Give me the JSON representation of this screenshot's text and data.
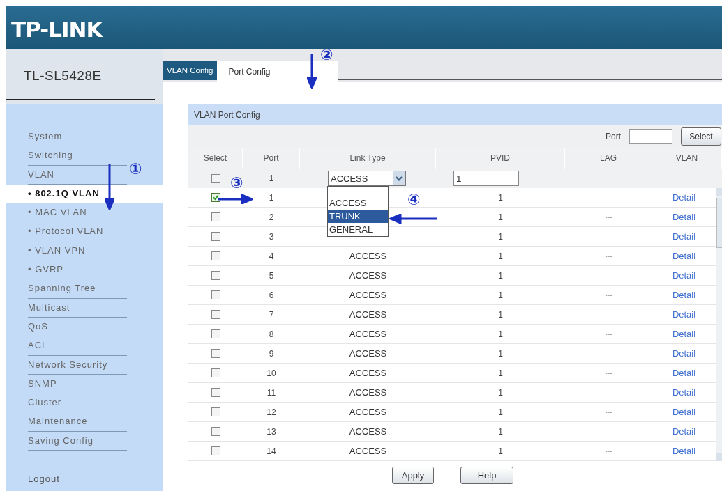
{
  "header": {
    "logo": "TP-LINK"
  },
  "sidebar": {
    "model": "TL-SL5428E",
    "items": [
      {
        "label": "System",
        "kind": "section",
        "selected": false
      },
      {
        "label": "Switching",
        "kind": "section",
        "selected": false
      },
      {
        "label": "VLAN",
        "kind": "section",
        "selected": false
      },
      {
        "label": "• 802.1Q VLAN",
        "kind": "sub",
        "selected": true
      },
      {
        "label": "• MAC VLAN",
        "kind": "sub",
        "selected": false
      },
      {
        "label": "• Protocol VLAN",
        "kind": "sub",
        "selected": false
      },
      {
        "label": "• VLAN VPN",
        "kind": "sub",
        "selected": false
      },
      {
        "label": "• GVRP",
        "kind": "sub",
        "selected": false
      },
      {
        "label": "Spanning Tree",
        "kind": "section",
        "selected": false
      },
      {
        "label": "Multicast",
        "kind": "section",
        "selected": false
      },
      {
        "label": "QoS",
        "kind": "section",
        "selected": false
      },
      {
        "label": "ACL",
        "kind": "section",
        "selected": false
      },
      {
        "label": "Network Security",
        "kind": "section",
        "selected": false
      },
      {
        "label": "SNMP",
        "kind": "section",
        "selected": false
      },
      {
        "label": "Cluster",
        "kind": "section",
        "selected": false
      },
      {
        "label": "Maintenance",
        "kind": "section",
        "selected": false
      },
      {
        "label": "Saving Config",
        "kind": "section",
        "selected": false
      }
    ],
    "logout": "Logout"
  },
  "tabs": [
    {
      "label": "VLAN Config",
      "selected": false
    },
    {
      "label": "Port Config",
      "selected": true
    }
  ],
  "panel": {
    "title": "VLAN Port Config",
    "port_label": "Port",
    "select_button": "Select",
    "columns": [
      "Select",
      "Port",
      "Link Type",
      "PVID",
      "LAG",
      "VLAN"
    ],
    "edit_row": {
      "checked": false,
      "port": "1",
      "link_type": "ACCESS",
      "pvid": "1"
    },
    "dropdown": [
      {
        "label": "ACCESS",
        "selected": false
      },
      {
        "label": "TRUNK",
        "selected": true
      },
      {
        "label": "GENERAL",
        "selected": false
      }
    ],
    "rows": [
      {
        "checked": true,
        "port": "1",
        "pvid": "1",
        "lag": "---",
        "vlan": "Detail"
      },
      {
        "checked": false,
        "port": "2",
        "pvid": "1",
        "lag": "---",
        "vlan": "Detail"
      },
      {
        "checked": false,
        "port": "3",
        "pvid": "1",
        "lag": "---",
        "vlan": "Detail"
      },
      {
        "checked": false,
        "port": "4",
        "link_type": "ACCESS",
        "pvid": "1",
        "lag": "---",
        "vlan": "Detail"
      },
      {
        "checked": false,
        "port": "5",
        "link_type": "ACCESS",
        "pvid": "1",
        "lag": "---",
        "vlan": "Detail"
      },
      {
        "checked": false,
        "port": "6",
        "link_type": "ACCESS",
        "pvid": "1",
        "lag": "---",
        "vlan": "Detail"
      },
      {
        "checked": false,
        "port": "7",
        "link_type": "ACCESS",
        "pvid": "1",
        "lag": "---",
        "vlan": "Detail"
      },
      {
        "checked": false,
        "port": "8",
        "link_type": "ACCESS",
        "pvid": "1",
        "lag": "---",
        "vlan": "Detail"
      },
      {
        "checked": false,
        "port": "9",
        "link_type": "ACCESS",
        "pvid": "1",
        "lag": "---",
        "vlan": "Detail"
      },
      {
        "checked": false,
        "port": "10",
        "link_type": "ACCESS",
        "pvid": "1",
        "lag": "---",
        "vlan": "Detail"
      },
      {
        "checked": false,
        "port": "11",
        "link_type": "ACCESS",
        "pvid": "1",
        "lag": "---",
        "vlan": "Detail"
      },
      {
        "checked": false,
        "port": "12",
        "link_type": "ACCESS",
        "pvid": "1",
        "lag": "---",
        "vlan": "Detail"
      },
      {
        "checked": false,
        "port": "13",
        "link_type": "ACCESS",
        "pvid": "1",
        "lag": "---",
        "vlan": "Detail"
      },
      {
        "checked": false,
        "port": "14",
        "link_type": "ACCESS",
        "pvid": "1",
        "lag": "---",
        "vlan": "Detail"
      }
    ],
    "buttons": [
      "Apply",
      "Help"
    ]
  },
  "annotations": [
    {
      "label": "①"
    },
    {
      "label": "②"
    },
    {
      "label": "③"
    },
    {
      "label": "④"
    }
  ]
}
